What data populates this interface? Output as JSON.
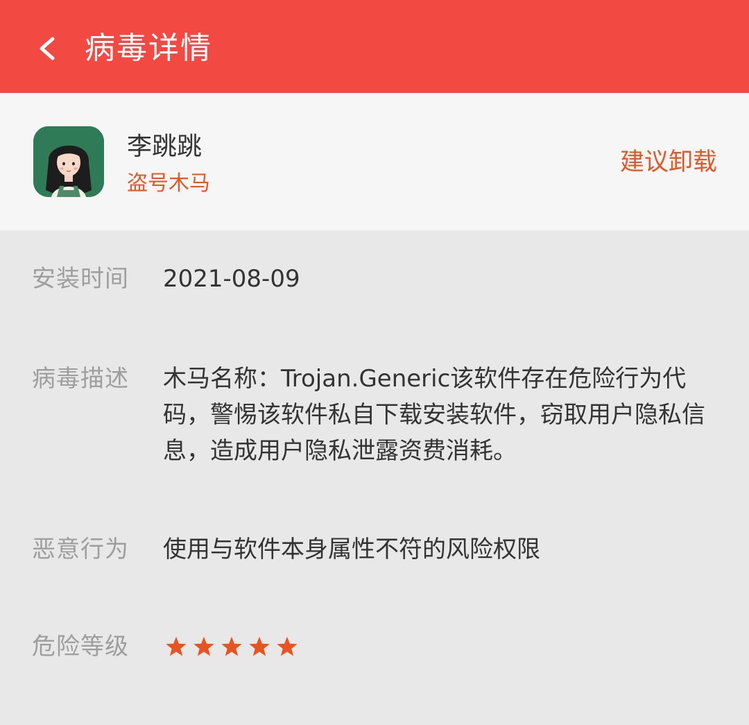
{
  "header": {
    "title": "病毒详情"
  },
  "app": {
    "name": "李跳跳",
    "tag": "盗号木马",
    "action_label": "建议卸载"
  },
  "details": {
    "install_time": {
      "label": "安装时间",
      "value": "2021-08-09"
    },
    "description": {
      "label": "病毒描述",
      "value": "木马名称：Trojan.Generic该软件存在危险行为代码，警惕该软件私自下载安装软件，窃取用户隐私信息，造成用户隐私泄露资费消耗。"
    },
    "behavior": {
      "label": "恶意行为",
      "value": "使用与软件本身属性不符的风险权限"
    },
    "risk_level": {
      "label": "危险等级",
      "stars": 5,
      "max_stars": 5
    }
  },
  "colors": {
    "header": "#f24a42",
    "accent": "#e05a28",
    "star": "#e8531f"
  }
}
